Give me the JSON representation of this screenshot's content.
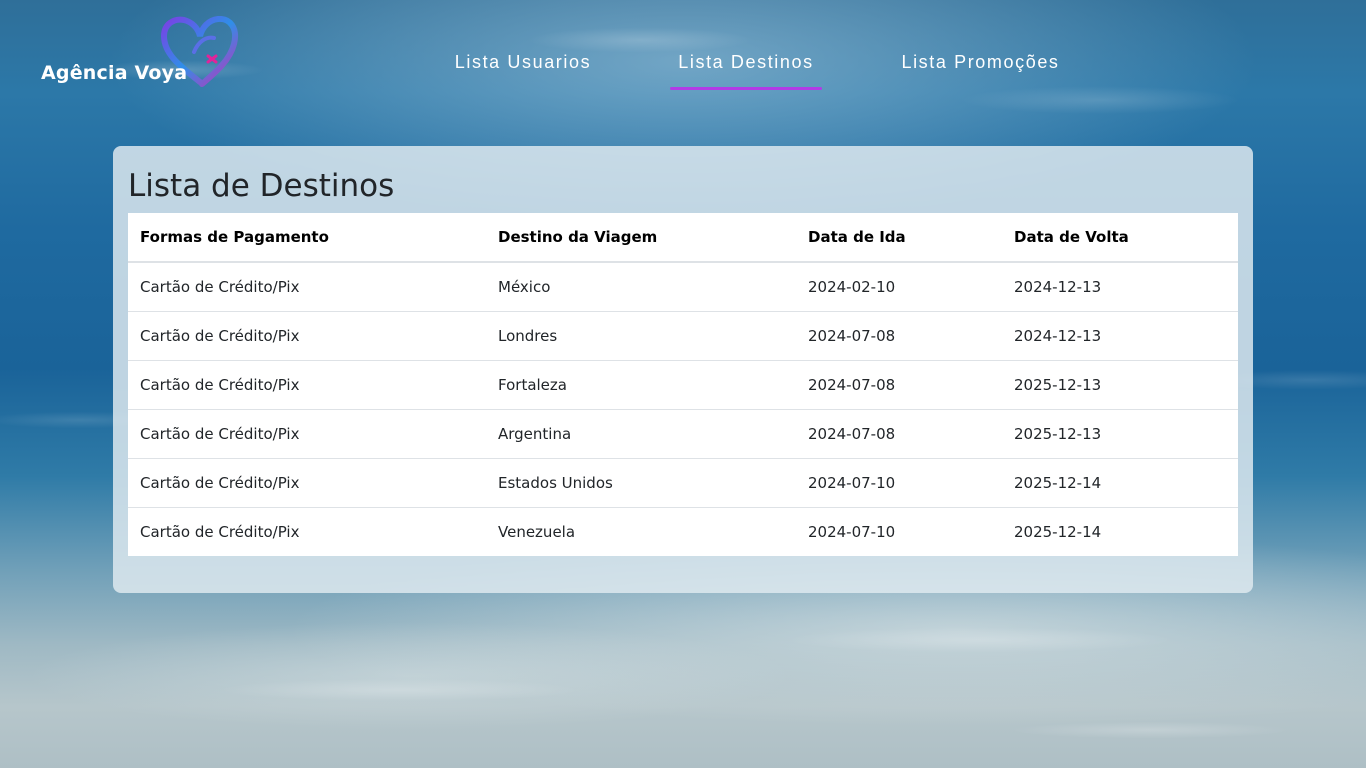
{
  "brand": {
    "name": "Agência Voya",
    "heart_colors": [
      "#7b3fe4",
      "#2f8fe8",
      "#e0249a"
    ]
  },
  "nav": {
    "items": [
      {
        "label": "Lista Usuarios",
        "active": false
      },
      {
        "label": "Lista Destinos",
        "active": true
      },
      {
        "label": "Lista Promoções",
        "active": false
      }
    ],
    "active_underline_color": "#b23be6"
  },
  "main": {
    "title": "Lista de Destinos",
    "table": {
      "headers": [
        "Formas de Pagamento",
        "Destino da Viagem",
        "Data de Ida",
        "Data de Volta"
      ],
      "rows": [
        [
          "Cartão de Crédito/Pix",
          "México",
          "2024-02-10",
          "2024-12-13"
        ],
        [
          "Cartão de Crédito/Pix",
          "Londres",
          "2024-07-08",
          "2024-12-13"
        ],
        [
          "Cartão de Crédito/Pix",
          "Fortaleza",
          "2024-07-08",
          "2025-12-13"
        ],
        [
          "Cartão de Crédito/Pix",
          "Argentina",
          "2024-07-08",
          "2025-12-13"
        ],
        [
          "Cartão de Crédito/Pix",
          "Estados Unidos",
          "2024-07-10",
          "2025-12-14"
        ],
        [
          "Cartão de Crédito/Pix",
          "Venezuela",
          "2024-07-10",
          "2025-12-14"
        ]
      ]
    }
  }
}
